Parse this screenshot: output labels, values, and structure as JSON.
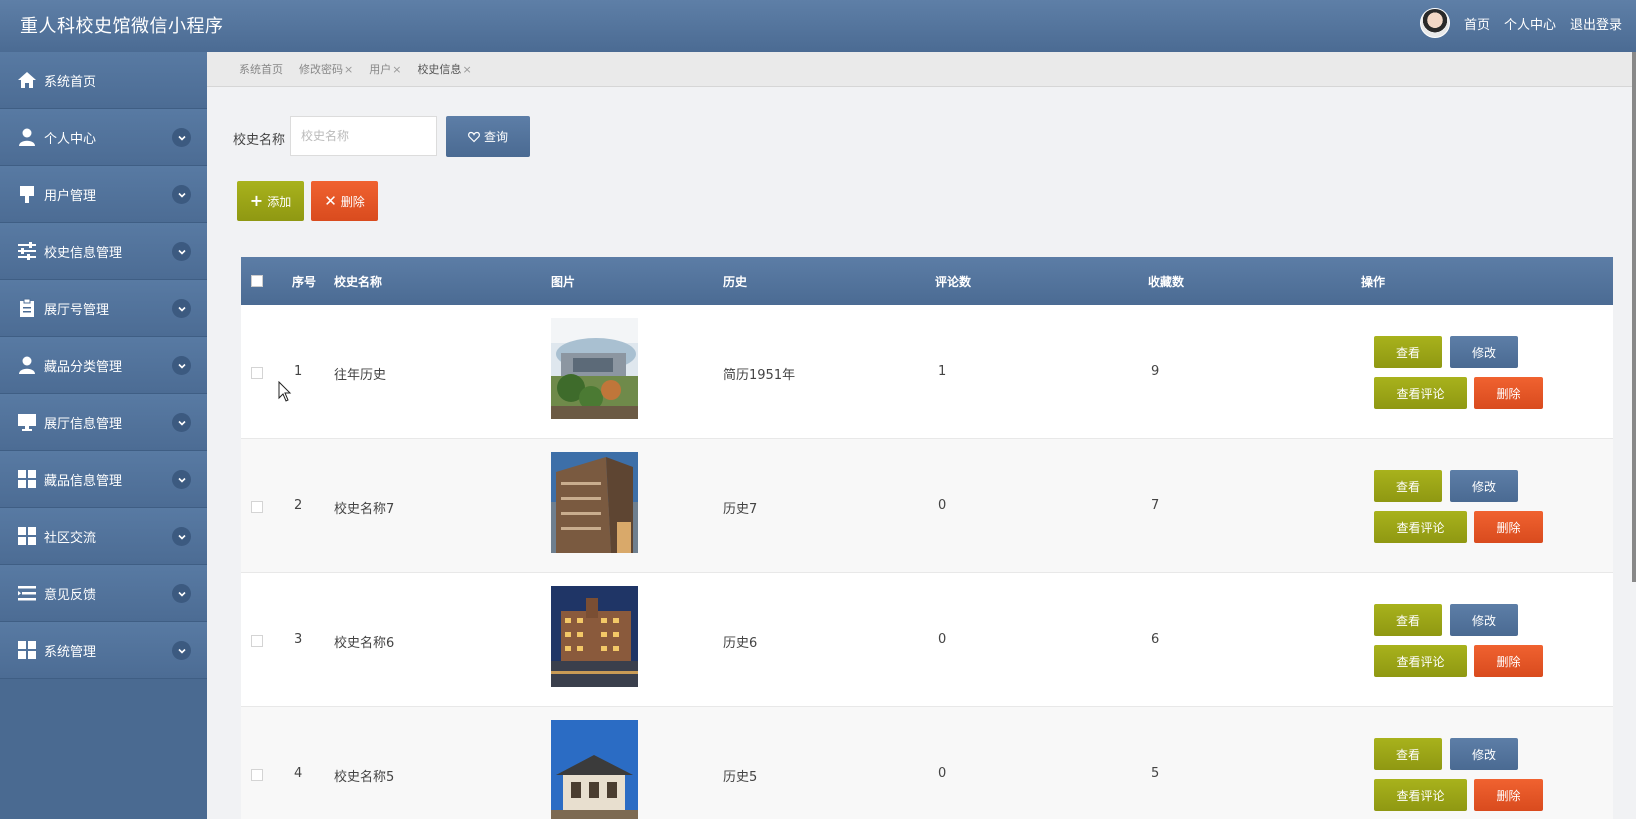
{
  "app": {
    "title": "重人科校史馆微信小程序"
  },
  "header": {
    "links": {
      "home": "首页",
      "profile": "个人中心",
      "logout": "退出登录"
    }
  },
  "sidebar": {
    "items": [
      {
        "label": "系统首页",
        "icon": "home-icon",
        "expandable": false
      },
      {
        "label": "个人中心",
        "icon": "person-icon",
        "expandable": true
      },
      {
        "label": "用户管理",
        "icon": "brush-icon",
        "expandable": true
      },
      {
        "label": "校史信息管理",
        "icon": "sliders-icon",
        "expandable": true
      },
      {
        "label": "展厅号管理",
        "icon": "clipboard-icon",
        "expandable": true
      },
      {
        "label": "藏品分类管理",
        "icon": "person-icon",
        "expandable": true
      },
      {
        "label": "展厅信息管理",
        "icon": "monitor-icon",
        "expandable": true
      },
      {
        "label": "藏品信息管理",
        "icon": "grid-icon",
        "expandable": true
      },
      {
        "label": "社区交流",
        "icon": "grid-icon",
        "expandable": true
      },
      {
        "label": "意见反馈",
        "icon": "list-icon",
        "expandable": true
      },
      {
        "label": "系统管理",
        "icon": "grid-icon",
        "expandable": true
      }
    ]
  },
  "tabs": [
    {
      "label": "系统首页",
      "closable": false
    },
    {
      "label": "修改密码",
      "closable": true
    },
    {
      "label": "用户",
      "closable": true
    },
    {
      "label": "校史信息",
      "closable": true,
      "active": true
    }
  ],
  "search": {
    "label": "校史名称",
    "placeholder": "校史名称",
    "value": "",
    "button": "查询"
  },
  "toolbar": {
    "add": "添加",
    "delete": "删除"
  },
  "table": {
    "columns": [
      "序号",
      "校史名称",
      "图片",
      "历史",
      "评论数",
      "收藏数",
      "操作"
    ],
    "rows": [
      {
        "index": "1",
        "name": "往年历史",
        "history": "简历1951年",
        "comments": "1",
        "favorites": "9",
        "image": "campus-garden"
      },
      {
        "index": "2",
        "name": "校史名称7",
        "history": "历史7",
        "comments": "0",
        "favorites": "7",
        "image": "brick-building"
      },
      {
        "index": "3",
        "name": "校史名称6",
        "history": "历史6",
        "comments": "0",
        "favorites": "6",
        "image": "night-building"
      },
      {
        "index": "4",
        "name": "校史名称5",
        "history": "历史5",
        "comments": "0",
        "favorites": "5",
        "image": "traditional-hall"
      }
    ],
    "actions": {
      "view": "查看",
      "edit": "修改",
      "comments": "查看评论",
      "delete": "删除"
    }
  },
  "colors": {
    "header": "#5e7fa7",
    "sidebar": "#4a6a91",
    "olive": "#a8b21c",
    "orange": "#f06230",
    "blue": "#4b6b93"
  }
}
